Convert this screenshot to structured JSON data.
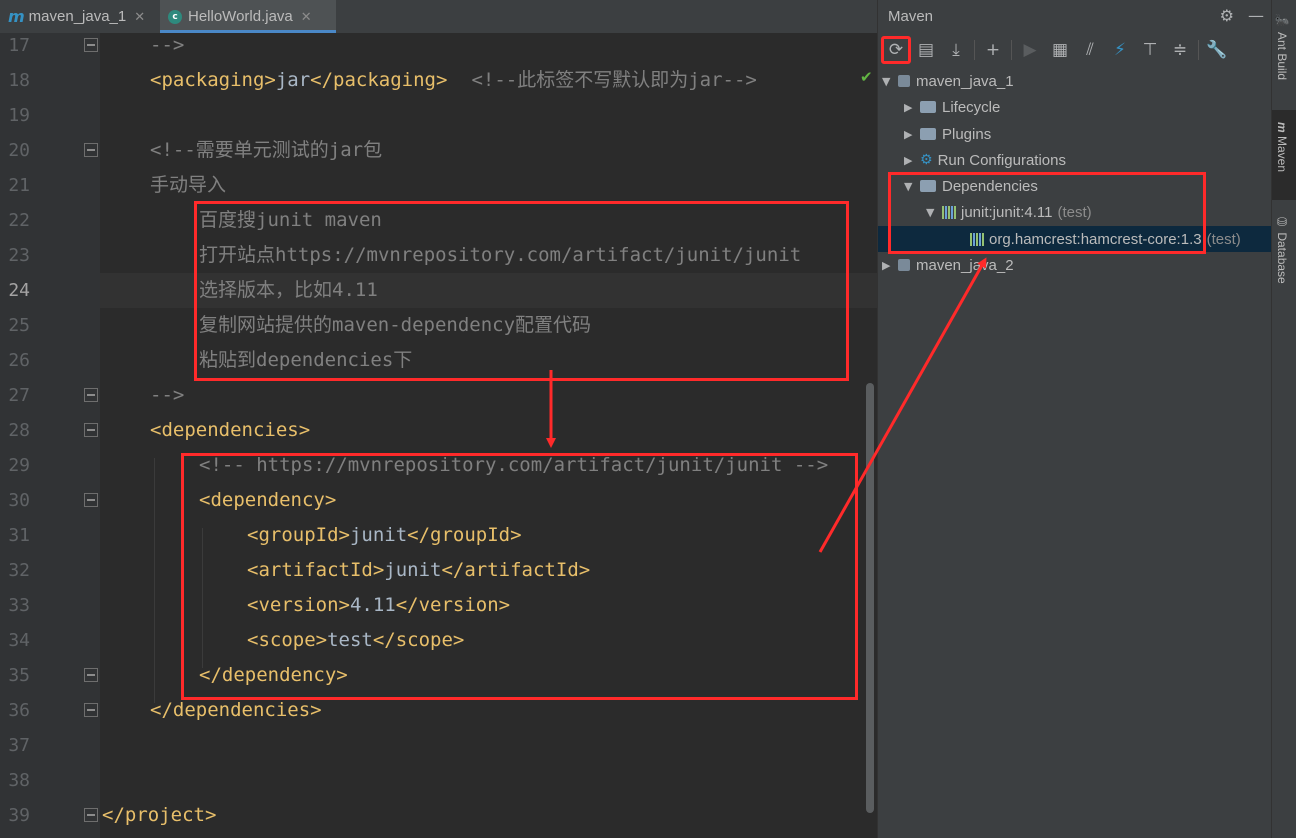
{
  "tabs": [
    {
      "icon": "m",
      "label": "maven_java_1",
      "active": false
    },
    {
      "icon": "c",
      "label": "HelloWorld.java",
      "active": true
    }
  ],
  "editor": {
    "line_numbers": [
      "17",
      "18",
      "19",
      "20",
      "21",
      "22",
      "23",
      "24",
      "25",
      "26",
      "27",
      "28",
      "29",
      "30",
      "31",
      "32",
      "33",
      "34",
      "35",
      "36",
      "37",
      "38",
      "39"
    ],
    "current_line": "24",
    "lines": {
      "l17": "-->",
      "l18_open": "<packaging>",
      "l18_text": "jar",
      "l18_close": "</packaging>",
      "l18_comment": "<!--此标签不写默认即为jar-->",
      "l20": "<!--需要单元测试的jar包",
      "l21": "手动导入",
      "l22": "百度搜junit maven",
      "l23": "打开站点https://mvnrepository.com/artifact/junit/junit",
      "l24": "选择版本，比如4.11",
      "l25": "复制网站提供的maven-dependency配置代码",
      "l26": "粘贴到dependencies下",
      "l27": "-->",
      "l28": "<dependencies>",
      "l29": "<!-- https://mvnrepository.com/artifact/junit/junit -->",
      "l30": "<dependency>",
      "l31_open": "<groupId>",
      "l31_text": "junit",
      "l31_close": "</groupId>",
      "l32_open": "<artifactId>",
      "l32_text": "junit",
      "l32_close": "</artifactId>",
      "l33_open": "<version>",
      "l33_text": "4.11",
      "l33_close": "</version>",
      "l34_open": "<scope>",
      "l34_text": "test",
      "l34_close": "</scope>",
      "l35": "</dependency>",
      "l36": "</dependencies>",
      "l39": "</project>"
    }
  },
  "maven_panel": {
    "title": "Maven",
    "tree": {
      "project1": "maven_java_1",
      "lifecycle": "Lifecycle",
      "plugins": "Plugins",
      "run_configs": "Run Configurations",
      "dependencies": "Dependencies",
      "junit": "junit:junit:4.11",
      "junit_scope": "(test)",
      "hamcrest": "org.hamcrest:hamcrest-core:1.3",
      "hamcrest_scope": "(test)",
      "project2": "maven_java_2"
    }
  },
  "side_strip": {
    "ant_build": "Ant Build",
    "maven": "Maven",
    "database": "Database"
  },
  "colors": {
    "annotation_red": "#ff2a2a",
    "xml_tag": "#e8bf6a",
    "comment": "#808080",
    "text": "#a9b7c6"
  }
}
